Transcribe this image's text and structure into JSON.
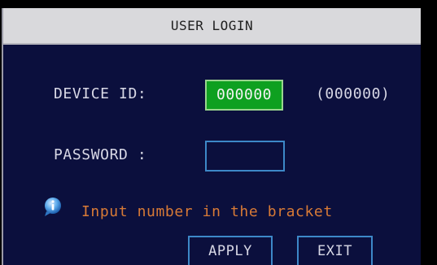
{
  "dialog": {
    "title": "USER LOGIN",
    "device_id": {
      "label": "DEVICE ID:",
      "value": "000000",
      "hint": "(000000)"
    },
    "password": {
      "label": "PASSWORD :",
      "value": ""
    },
    "info_icon": "info-icon",
    "hint_text": "Input number in the bracket",
    "buttons": {
      "apply": "APPLY",
      "exit": "EXIT"
    }
  },
  "colors": {
    "background": "#0b0f3d",
    "title_bar": "#d9d9dc",
    "selected_field": "#0ea020",
    "field_border": "#3d88c8",
    "hint_text": "#d87a36",
    "label_text": "#d8d8e6"
  }
}
